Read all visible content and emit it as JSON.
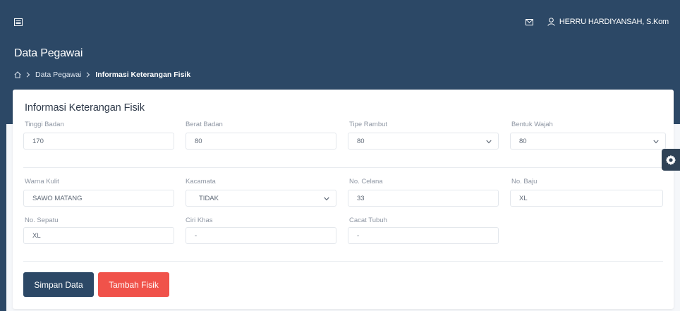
{
  "header": {
    "user_name": "HERRU HARDIYANSAH, S.Kom"
  },
  "page": {
    "title": "Data Pegawai",
    "breadcrumb": [
      "Data Pegawai",
      "Informasi Keterangan Fisik"
    ]
  },
  "form": {
    "section_title": "Informasi Keterangan Fisik",
    "fields": {
      "tinggi_badan": {
        "label": "Tinggi Badan",
        "value": "170"
      },
      "berat_badan": {
        "label": "Berat Badan",
        "value": "80"
      },
      "tipe_rambut": {
        "label": "Tipe Rambut",
        "value": "80"
      },
      "bentuk_wajah": {
        "label": "Bentuk Wajah",
        "value": "80"
      },
      "warna_kulit": {
        "label": "Warna Kulit",
        "value": "SAWO MATANG"
      },
      "kacamata": {
        "label": "Kacamata",
        "value": "TIDAK"
      },
      "no_celana": {
        "label": "No. Celana",
        "value": "33"
      },
      "no_baju": {
        "label": "No. Baju",
        "value": "XL"
      },
      "no_sepatu": {
        "label": "No. Sepatu",
        "value": "XL"
      },
      "ciri_khas": {
        "label": "Ciri Khas",
        "value": "-"
      },
      "cacat_tubuh": {
        "label": "Cacat Tubuh",
        "value": "-"
      }
    },
    "buttons": {
      "save": "Simpan Data",
      "add": "Tambah Fisik"
    }
  },
  "colors": {
    "header_bg": "#2c4866",
    "primary": "#2c4866",
    "danger": "#f0524a"
  },
  "icons": [
    "menu-icon",
    "mail-icon",
    "user-icon",
    "home-icon",
    "chevron-right-icon",
    "chevron-down-icon",
    "gear-icon"
  ]
}
